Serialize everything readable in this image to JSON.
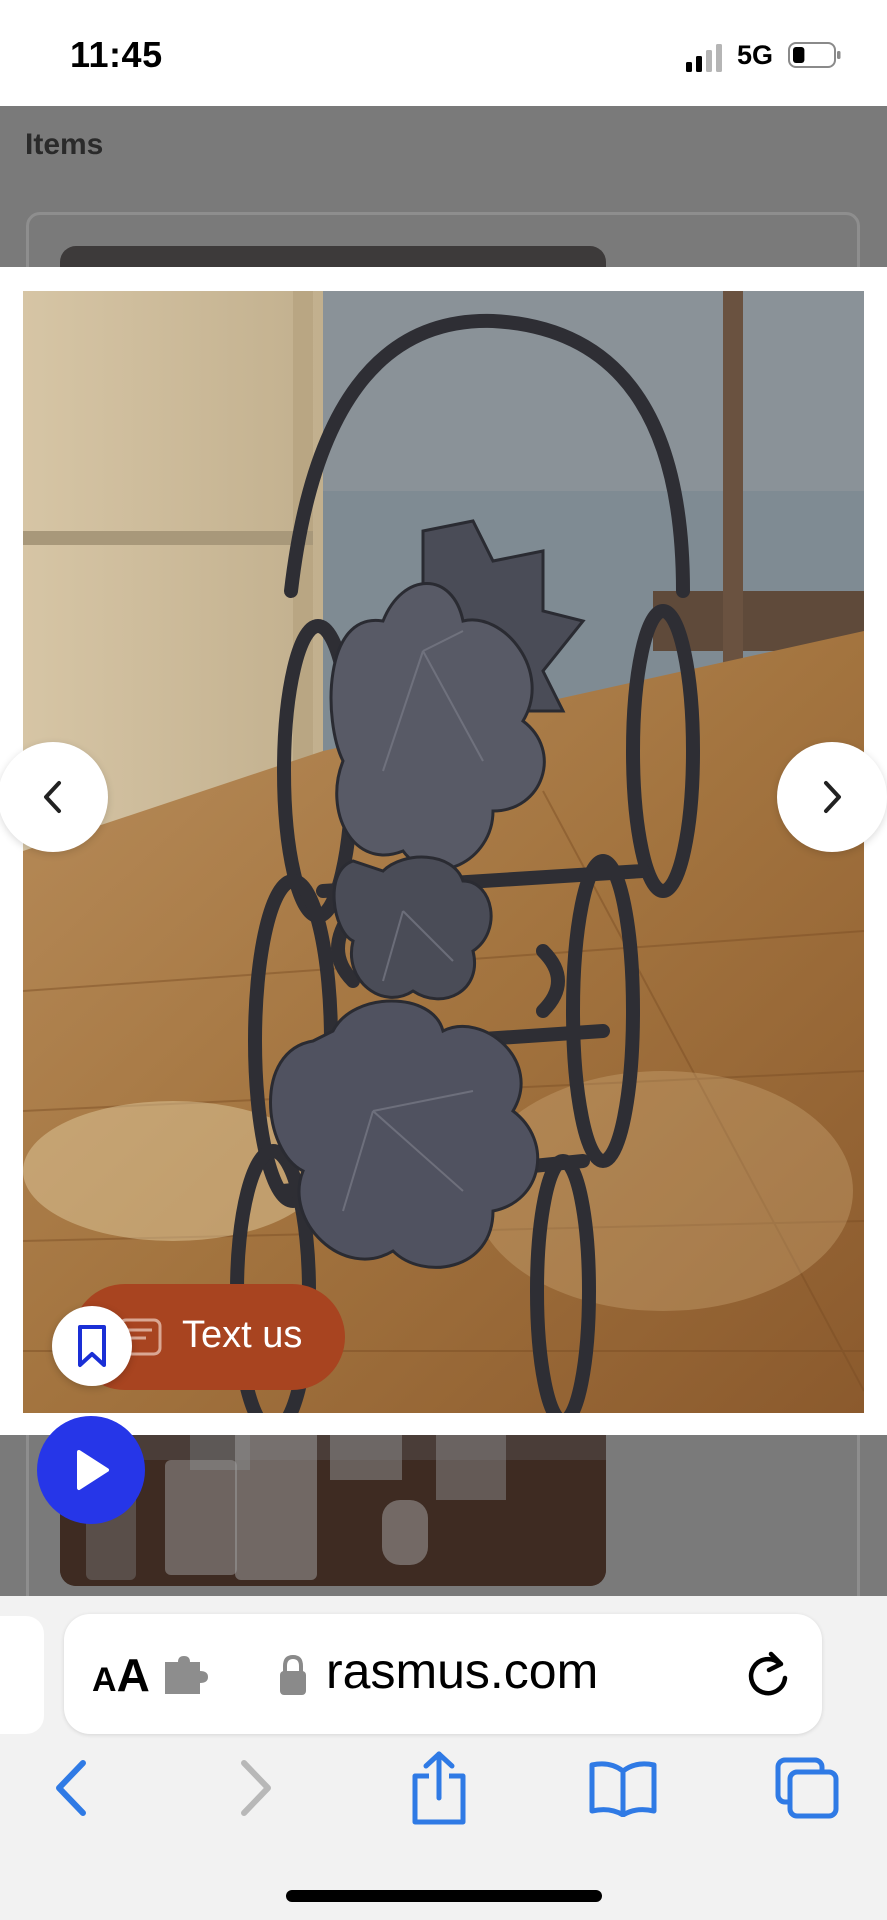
{
  "status_bar": {
    "time": "11:45",
    "network": "5G",
    "battery_level": 0.3
  },
  "page": {
    "section_title": "Items"
  },
  "modal": {
    "image_alt": "Wrought iron grape-leaf wine rack on wooden floor",
    "prev_icon": "chevron-left-icon",
    "next_icon": "chevron-right-icon"
  },
  "chat": {
    "label": "Text us"
  },
  "browser": {
    "aa_label_small": "A",
    "aa_label_big": "A",
    "url": "rasmus.com"
  },
  "colors": {
    "text_us_bg": "#a84420",
    "play_bg": "#2636e8",
    "safari_blue": "#2f7ae5",
    "dim_overlay": "#7a7a7a"
  }
}
